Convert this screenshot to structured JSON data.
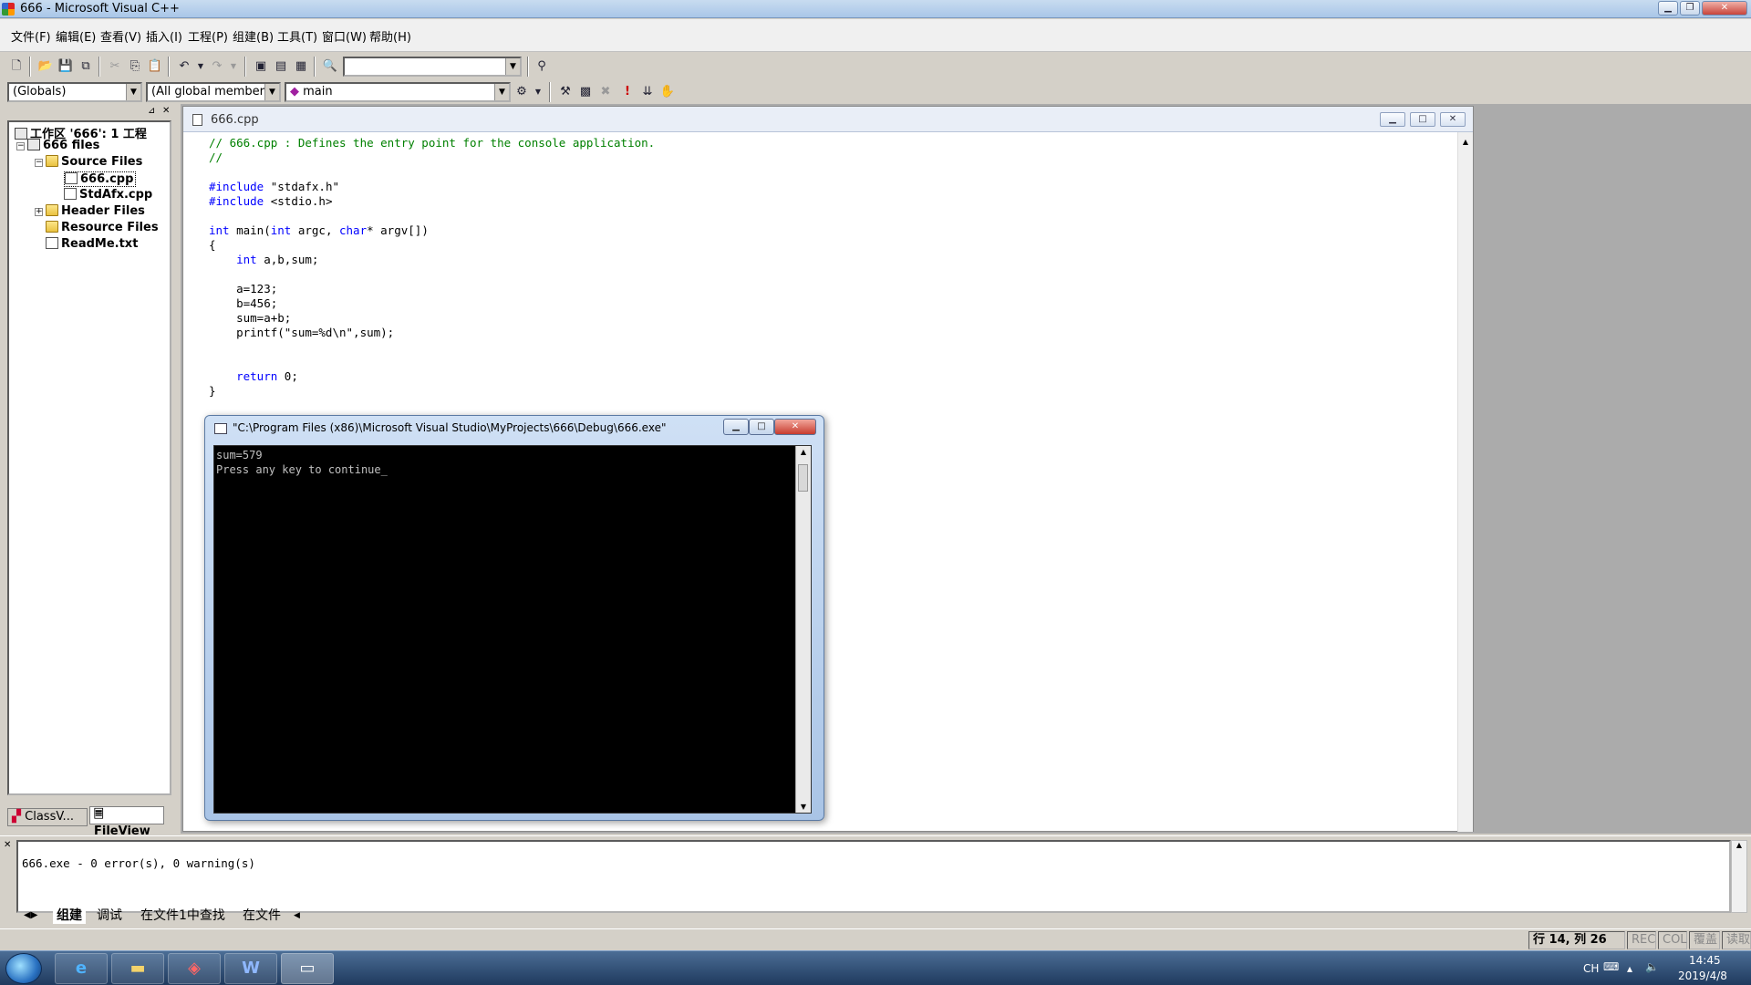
{
  "window": {
    "title": "666 - Microsoft Visual C++"
  },
  "menu": [
    "文件(F)",
    "编辑(E)",
    "查看(V)",
    "插入(I)",
    "工程(P)",
    "组建(B)",
    "工具(T)",
    "窗口(W)",
    "帮助(H)"
  ],
  "wizardbar": {
    "class_combo": "(Globals)",
    "filter_combo": "(All global members",
    "function_combo": "main"
  },
  "workspace": {
    "tree": [
      {
        "label": "工作区 '666': 1 工程",
        "icon": "workspace-icon"
      },
      {
        "label": "666 files",
        "icon": "project-icon"
      },
      {
        "label": "Source Files",
        "icon": "folder-icon"
      },
      {
        "label": "666.cpp",
        "icon": "cpp-file-icon"
      },
      {
        "label": "StdAfx.cpp",
        "icon": "cpp-file-icon"
      },
      {
        "label": "Header Files",
        "icon": "folder-icon"
      },
      {
        "label": "Resource Files",
        "icon": "folder-icon"
      },
      {
        "label": "ReadMe.txt",
        "icon": "text-file-icon"
      }
    ],
    "tabs": [
      "ClassV...",
      "FileView"
    ]
  },
  "editor": {
    "title": "666.cpp",
    "code": [
      "// 666.cpp : Defines the entry point for the console application.",
      "//",
      "",
      "#include \"stdafx.h\"",
      "#include <stdio.h>",
      "",
      "int main(int argc, char* argv[])",
      "{",
      "    int a,b,sum;",
      "",
      "    a=123;",
      "    b=456;",
      "    sum=a+b;",
      "    printf(\"sum=%d\\n\",sum);",
      "",
      "",
      "    return 0;",
      "}"
    ]
  },
  "console": {
    "title": "\"C:\\Program Files (x86)\\Microsoft Visual Studio\\MyProjects\\666\\Debug\\666.exe\"",
    "output": "sum=579\nPress any key to continue_"
  },
  "output": {
    "text": "666.exe - 0 error(s), 0 warning(s)",
    "tabs": [
      "组建",
      "调试",
      "在文件1中查找",
      "在文件"
    ]
  },
  "status": {
    "position": "行 14, 列 26",
    "rec": "REC",
    "col": "COL",
    "ovr": "覆盖",
    "read": "读取"
  },
  "taskbar": {
    "lang": "CH",
    "time": "14:45",
    "date": "2019/4/8"
  },
  "colors": {
    "keyword": "#0000ff",
    "comment": "#008000",
    "console_bg": "#000000"
  }
}
